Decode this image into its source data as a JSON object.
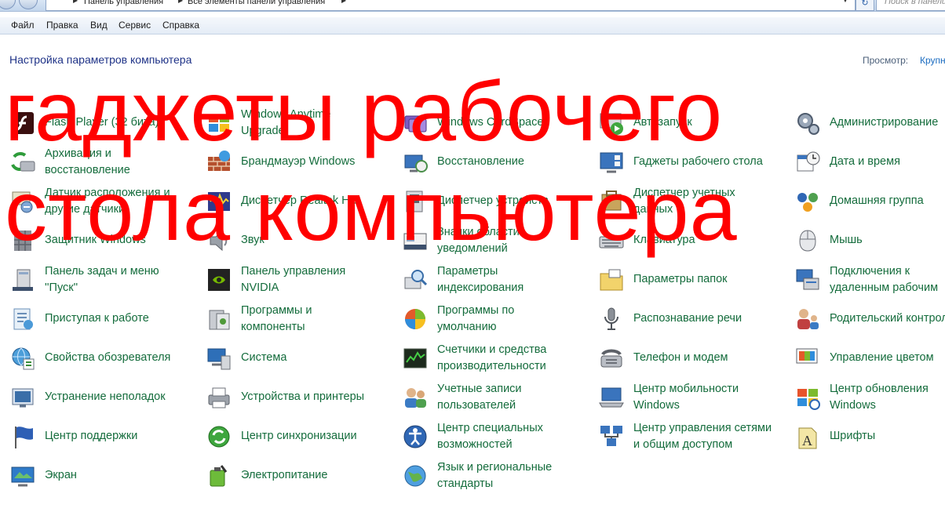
{
  "window": {
    "breadcrumb": [
      "Панель управления",
      "Все элементы панели управления"
    ],
    "search_placeholder": "Поиск в панели"
  },
  "menu": [
    "Файл",
    "Правка",
    "Вид",
    "Сервис",
    "Справка"
  ],
  "header": {
    "title": "Настройка параметров компьютера",
    "view_label": "Просмотр:",
    "view_value": "Крупные значки"
  },
  "overlay": {
    "line1": "гаджеты рабочего",
    "line2": "стола компьютера",
    "color": "#ff0000"
  },
  "columns": [
    [
      {
        "label": [
          "Flash Player (32 бита)"
        ],
        "icon": "flash-icon"
      },
      {
        "label": [
          "Архивация и",
          "восстановление"
        ],
        "icon": "backup-icon"
      },
      {
        "label": [
          "Датчик расположения и",
          "другие датчики"
        ],
        "icon": "sensor-icon"
      },
      {
        "label": [
          "Защитник Windows"
        ],
        "icon": "defender-icon"
      },
      {
        "label": [
          "Панель задач и меню",
          "''Пуск''"
        ],
        "icon": "taskbar-icon"
      },
      {
        "label": [
          "Приступая к работе"
        ],
        "icon": "getting-started-icon"
      },
      {
        "label": [
          "Свойства обозревателя"
        ],
        "icon": "internet-options-icon"
      },
      {
        "label": [
          "Устранение неполадок"
        ],
        "icon": "troubleshoot-icon"
      },
      {
        "label": [
          "Центр поддержки"
        ],
        "icon": "action-center-flag-icon"
      },
      {
        "label": [
          "Экран"
        ],
        "icon": "display-icon"
      }
    ],
    [
      {
        "label": [
          "Windows Anytime",
          "Upgrade"
        ],
        "icon": "anytime-upgrade-icon"
      },
      {
        "label": [
          "Брандмауэр Windows"
        ],
        "icon": "firewall-icon"
      },
      {
        "label": [
          "Диспетчер Realtek HD"
        ],
        "icon": "realtek-icon"
      },
      {
        "label": [
          "Звук"
        ],
        "icon": "speaker-icon"
      },
      {
        "label": [
          "Панель управления",
          "NVIDIA"
        ],
        "icon": "nvidia-icon"
      },
      {
        "label": [
          "Программы и",
          "компоненты"
        ],
        "icon": "programs-icon"
      },
      {
        "label": [
          "Система"
        ],
        "icon": "system-icon"
      },
      {
        "label": [
          "Устройства и принтеры"
        ],
        "icon": "printer-icon"
      },
      {
        "label": [
          "Центр синхронизации"
        ],
        "icon": "sync-icon"
      },
      {
        "label": [
          "Электропитание"
        ],
        "icon": "power-icon"
      }
    ],
    [
      {
        "label": [
          "Windows CardSpace"
        ],
        "icon": "cardspace-icon"
      },
      {
        "label": [
          "Восстановление"
        ],
        "icon": "recovery-icon"
      },
      {
        "label": [
          "Диспетчер устройств"
        ],
        "icon": "device-manager-icon"
      },
      {
        "label": [
          "Значки области",
          "уведомлений"
        ],
        "icon": "notification-icons-icon"
      },
      {
        "label": [
          "Параметры",
          "индексирования"
        ],
        "icon": "indexing-icon"
      },
      {
        "label": [
          "Программы по",
          "умолчанию"
        ],
        "icon": "default-programs-icon"
      },
      {
        "label": [
          "Счетчики и средства",
          "производительности"
        ],
        "icon": "performance-icon"
      },
      {
        "label": [
          "Учетные записи",
          "пользователей"
        ],
        "icon": "user-accounts-icon"
      },
      {
        "label": [
          "Центр специальных",
          "возможностей"
        ],
        "icon": "accessibility-icon"
      },
      {
        "label": [
          "Язык и региональные",
          "стандарты"
        ],
        "icon": "region-globe-icon"
      }
    ],
    [
      {
        "label": [
          "Автозапуск"
        ],
        "icon": "autoplay-icon"
      },
      {
        "label": [
          "Гаджеты рабочего стола"
        ],
        "icon": "gadgets-icon"
      },
      {
        "label": [
          "Диспетчер учетных",
          "данных"
        ],
        "icon": "credential-manager-icon"
      },
      {
        "label": [
          "Клавиатура"
        ],
        "icon": "keyboard-icon"
      },
      {
        "label": [
          "Параметры папок"
        ],
        "icon": "folder-options-icon"
      },
      {
        "label": [
          "Распознавание речи"
        ],
        "icon": "microphone-icon"
      },
      {
        "label": [
          "Телефон и модем"
        ],
        "icon": "phone-modem-icon"
      },
      {
        "label": [
          "Центр мобильности",
          "Windows"
        ],
        "icon": "mobility-center-icon"
      },
      {
        "label": [
          "Центр управления сетями",
          "и общим доступом"
        ],
        "icon": "network-center-icon"
      }
    ],
    [
      {
        "label": [
          "Администрирование"
        ],
        "icon": "admin-tools-icon"
      },
      {
        "label": [
          "Дата и время"
        ],
        "icon": "date-time-icon"
      },
      {
        "label": [
          "Домашняя группа"
        ],
        "icon": "homegroup-icon"
      },
      {
        "label": [
          "Мышь"
        ],
        "icon": "mouse-icon"
      },
      {
        "label": [
          "Подключения к",
          "удаленным рабочим"
        ],
        "icon": "remote-desktop-icon"
      },
      {
        "label": [
          "Родительский контроль"
        ],
        "icon": "parental-controls-icon"
      },
      {
        "label": [
          "Управление цветом"
        ],
        "icon": "color-management-icon"
      },
      {
        "label": [
          "Центр обновления",
          "Windows"
        ],
        "icon": "windows-update-icon"
      },
      {
        "label": [
          "Шрифты"
        ],
        "icon": "fonts-icon"
      }
    ]
  ]
}
